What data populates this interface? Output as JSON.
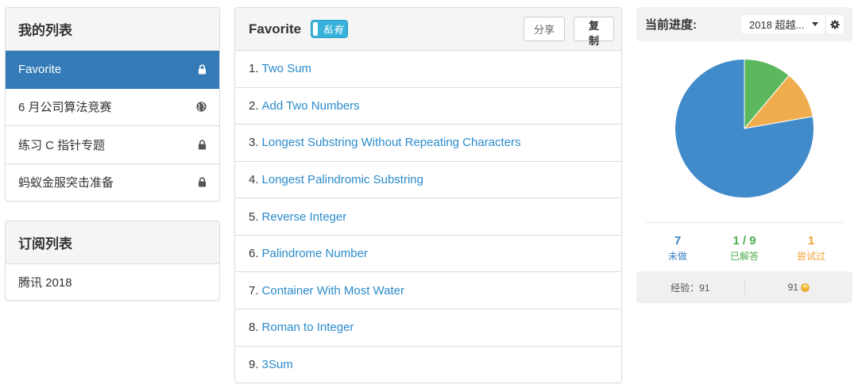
{
  "colors": {
    "accent": "#337ab7",
    "link": "#2a8bcc",
    "privacy_badge": "#36b1d9"
  },
  "left": {
    "my_lists": {
      "title": "我的列表",
      "items": [
        {
          "label": "Favorite",
          "icon": "lock-icon",
          "active": true
        },
        {
          "label": "6 月公司算法竞赛",
          "icon": "globe-icon",
          "active": false
        },
        {
          "label": "练习 C 指针专题",
          "icon": "lock-icon",
          "active": false
        },
        {
          "label": "蚂蚁金服突击准备",
          "icon": "lock-icon",
          "active": false
        }
      ]
    },
    "subscribed": {
      "title": "订阅列表",
      "items": [
        {
          "label": "腾讯 2018"
        }
      ]
    }
  },
  "main": {
    "title": "Favorite",
    "privacy_badge": "私有",
    "share_label": "分享",
    "copy_label": "复制",
    "problems": [
      {
        "num": "1.",
        "title": "Two Sum"
      },
      {
        "num": "2.",
        "title": "Add Two Numbers"
      },
      {
        "num": "3.",
        "title": "Longest Substring Without Repeating Characters"
      },
      {
        "num": "4.",
        "title": "Longest Palindromic Substring"
      },
      {
        "num": "5.",
        "title": "Reverse Integer"
      },
      {
        "num": "6.",
        "title": "Palindrome Number"
      },
      {
        "num": "7.",
        "title": "Container With Most Water"
      },
      {
        "num": "8.",
        "title": "Roman to Integer"
      },
      {
        "num": "9.",
        "title": "3Sum"
      }
    ]
  },
  "progress": {
    "title": "当前进度:",
    "session_select": {
      "value": "2018 超越..."
    },
    "settings_icon": "gear-icon",
    "pie": {
      "solved": {
        "value": 1,
        "color": "#5cb85c"
      },
      "attempted": {
        "value": 1,
        "color": "#f0ad4e"
      },
      "unsolved": {
        "value": 7,
        "color": "#428bca"
      }
    },
    "stats": {
      "unsolved": {
        "value": "7",
        "label": "未做"
      },
      "solved": {
        "value": "1 / 9",
        "label": "已解答"
      },
      "attempted": {
        "value": "1",
        "label": "尝试过"
      }
    },
    "experience": "经验：91",
    "coins": {
      "value": "91",
      "icon": "coin-icon"
    }
  }
}
